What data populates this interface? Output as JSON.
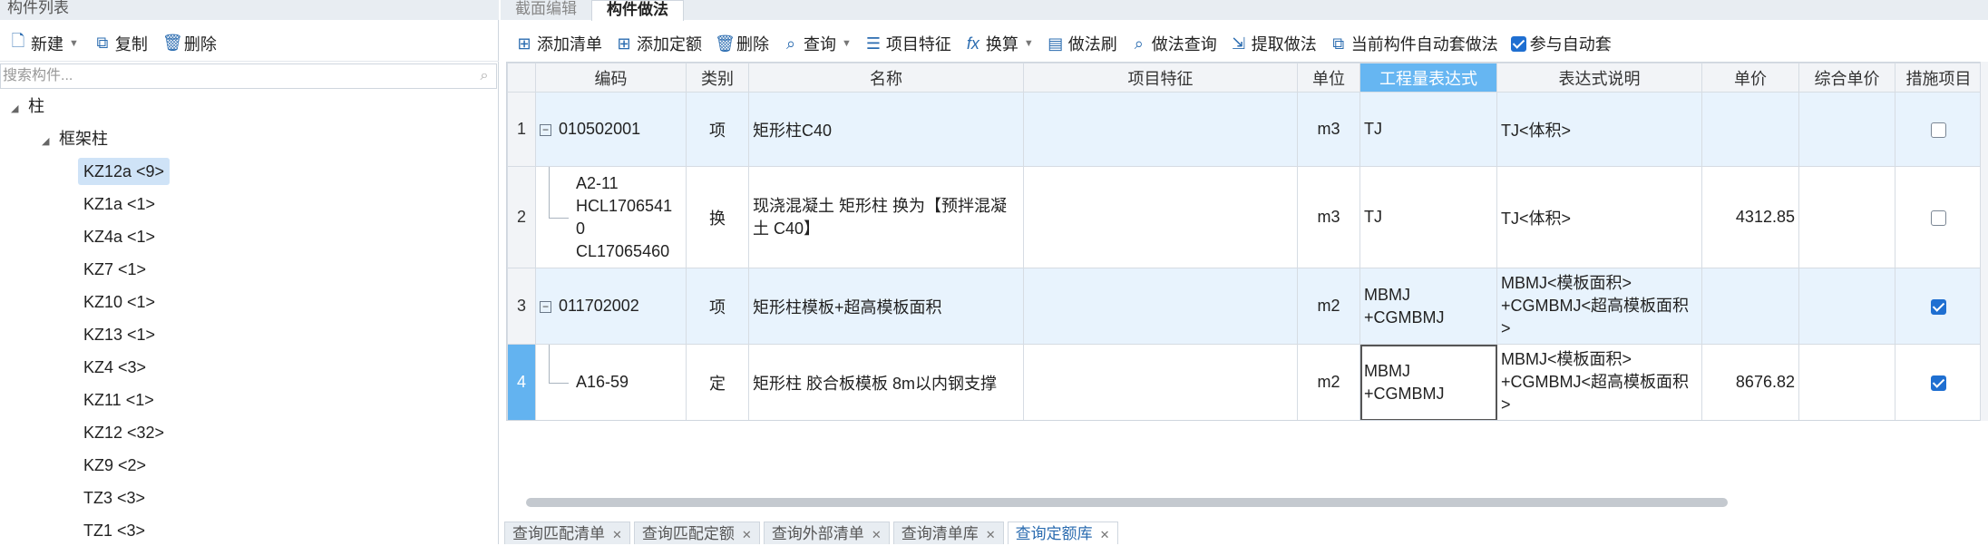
{
  "left_panel": {
    "title": "构件列表",
    "toolbar": {
      "new_label": "新建",
      "copy_label": "复制",
      "delete_label": "删除"
    },
    "search_placeholder": "搜索构件...",
    "tree": {
      "root": "柱",
      "group": "框架柱",
      "items": [
        "KZ12a <9>",
        "KZ1a <1>",
        "KZ4a <1>",
        "KZ7 <1>",
        "KZ10 <1>",
        "KZ13 <1>",
        "KZ4 <3>",
        "KZ11 <1>",
        "KZ12 <32>",
        "KZ9 <2>",
        "TZ3 <3>",
        "TZ1 <3>"
      ],
      "selected": "KZ12a <9>"
    }
  },
  "tabs": {
    "section_edit": "截面编辑",
    "component_method": "构件做法"
  },
  "toolbar": {
    "add_list": "添加清单",
    "add_quota": "添加定额",
    "delete": "删除",
    "query": "查询",
    "item_feature": "项目特征",
    "convert": "换算",
    "method_brush": "做法刷",
    "method_query": "做法查询",
    "extract_method": "提取做法",
    "auto_apply": "当前构件自动套做法",
    "participate_auto": "参与自动套",
    "participate_auto_checked": true
  },
  "grid": {
    "headers": {
      "code": "编码",
      "category": "类别",
      "name": "名称",
      "feature": "项目特征",
      "unit": "单位",
      "expression": "工程量表达式",
      "expr_desc": "表达式说明",
      "price": "单价",
      "total_price": "综合单价",
      "measure": "措施项目"
    },
    "rows": [
      {
        "num": "1",
        "code": "010502001",
        "category": "项",
        "name": "矩形柱C40",
        "feature": "",
        "unit": "m3",
        "expression": "TJ",
        "expr_desc": "TJ<体积>",
        "price": "",
        "total_price": "",
        "measure": false
      },
      {
        "num": "2",
        "code_lines": [
          "A2-11",
          "HCL1706541",
          "0",
          "CL17065460"
        ],
        "category": "换",
        "name_lines": [
          "现浇混凝土 矩形柱  换为【预拌混凝",
          "土 C40】"
        ],
        "feature": "",
        "unit": "m3",
        "expression": "TJ",
        "expr_desc": "TJ<体积>",
        "price": "4312.85",
        "total_price": "",
        "measure": false
      },
      {
        "num": "3",
        "code": "011702002",
        "category": "项",
        "name": "矩形柱模板+超高模板面积",
        "feature": "",
        "unit": "m2",
        "expression_lines": [
          "MBMJ",
          "+CGMBMJ"
        ],
        "expr_desc_lines": [
          "MBMJ<模板面积>",
          "+CGMBMJ<超高模板面积",
          ">"
        ],
        "price": "",
        "total_price": "",
        "measure": true
      },
      {
        "num": "4",
        "code": "A16-59",
        "category": "定",
        "name": "矩形柱 胶合板模板 8m以内钢支撑",
        "feature": "",
        "unit": "m2",
        "expression_lines": [
          "MBMJ",
          "+CGMBMJ"
        ],
        "expr_desc_lines": [
          "MBMJ<模板面积>",
          "+CGMBMJ<超高模板面积",
          ">"
        ],
        "price": "8676.82",
        "total_price": "",
        "measure": true
      }
    ]
  },
  "bottom_tabs": [
    "查询匹配清单",
    "查询匹配定额",
    "查询外部清单",
    "查询清单库",
    "查询定额库"
  ],
  "bottom_tab_active": "查询定额库"
}
